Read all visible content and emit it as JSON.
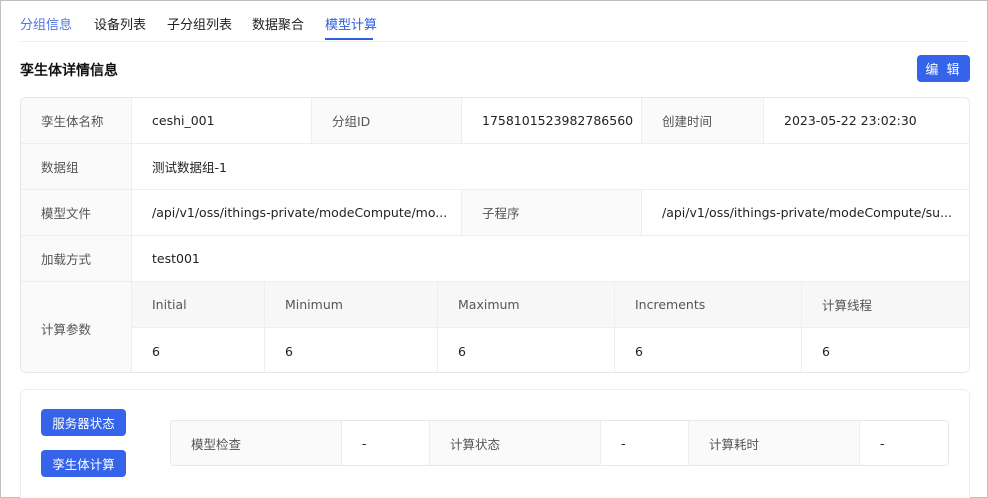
{
  "tabs": [
    {
      "label": "分组信息"
    },
    {
      "label": "设备列表"
    },
    {
      "label": "子分组列表"
    },
    {
      "label": "数据聚合"
    },
    {
      "label": "模型计算"
    }
  ],
  "header": {
    "title": "孪生体详情信息",
    "edit_label": "编 辑"
  },
  "detail": {
    "name_label": "孪生体名称",
    "name_value": "ceshi_001",
    "group_id_label": "分组ID",
    "group_id_value": "1758101523982786560",
    "created_label": "创建时间",
    "created_value": "2023-05-22 23:02:30",
    "data_group_label": "数据组",
    "data_group_value": "测试数据组-1",
    "model_file_label": "模型文件",
    "model_file_value": "/api/v1/oss/ithings-private/modeCompute/mo...",
    "subprogram_label": "子程序",
    "subprogram_value": "/api/v1/oss/ithings-private/modeCompute/su...",
    "load_label": "加载方式",
    "load_value": "test001",
    "params_label": "计算参数",
    "params": {
      "headers": [
        "Initial",
        "Minimum",
        "Maximum",
        "Increments",
        "计算线程"
      ],
      "values": [
        "6",
        "6",
        "6",
        "6",
        "6"
      ]
    }
  },
  "actions": {
    "server_status_label": "服务器状态",
    "twin_compute_label": "孪生体计算"
  },
  "status": {
    "model_check_label": "模型检查",
    "model_check_value": "-",
    "compute_status_label": "计算状态",
    "compute_status_value": "-",
    "compute_time_label": "计算耗时",
    "compute_time_value": "-"
  },
  "colors": {
    "primary": "#3563e9",
    "active_tab": "#2f5fe0"
  }
}
